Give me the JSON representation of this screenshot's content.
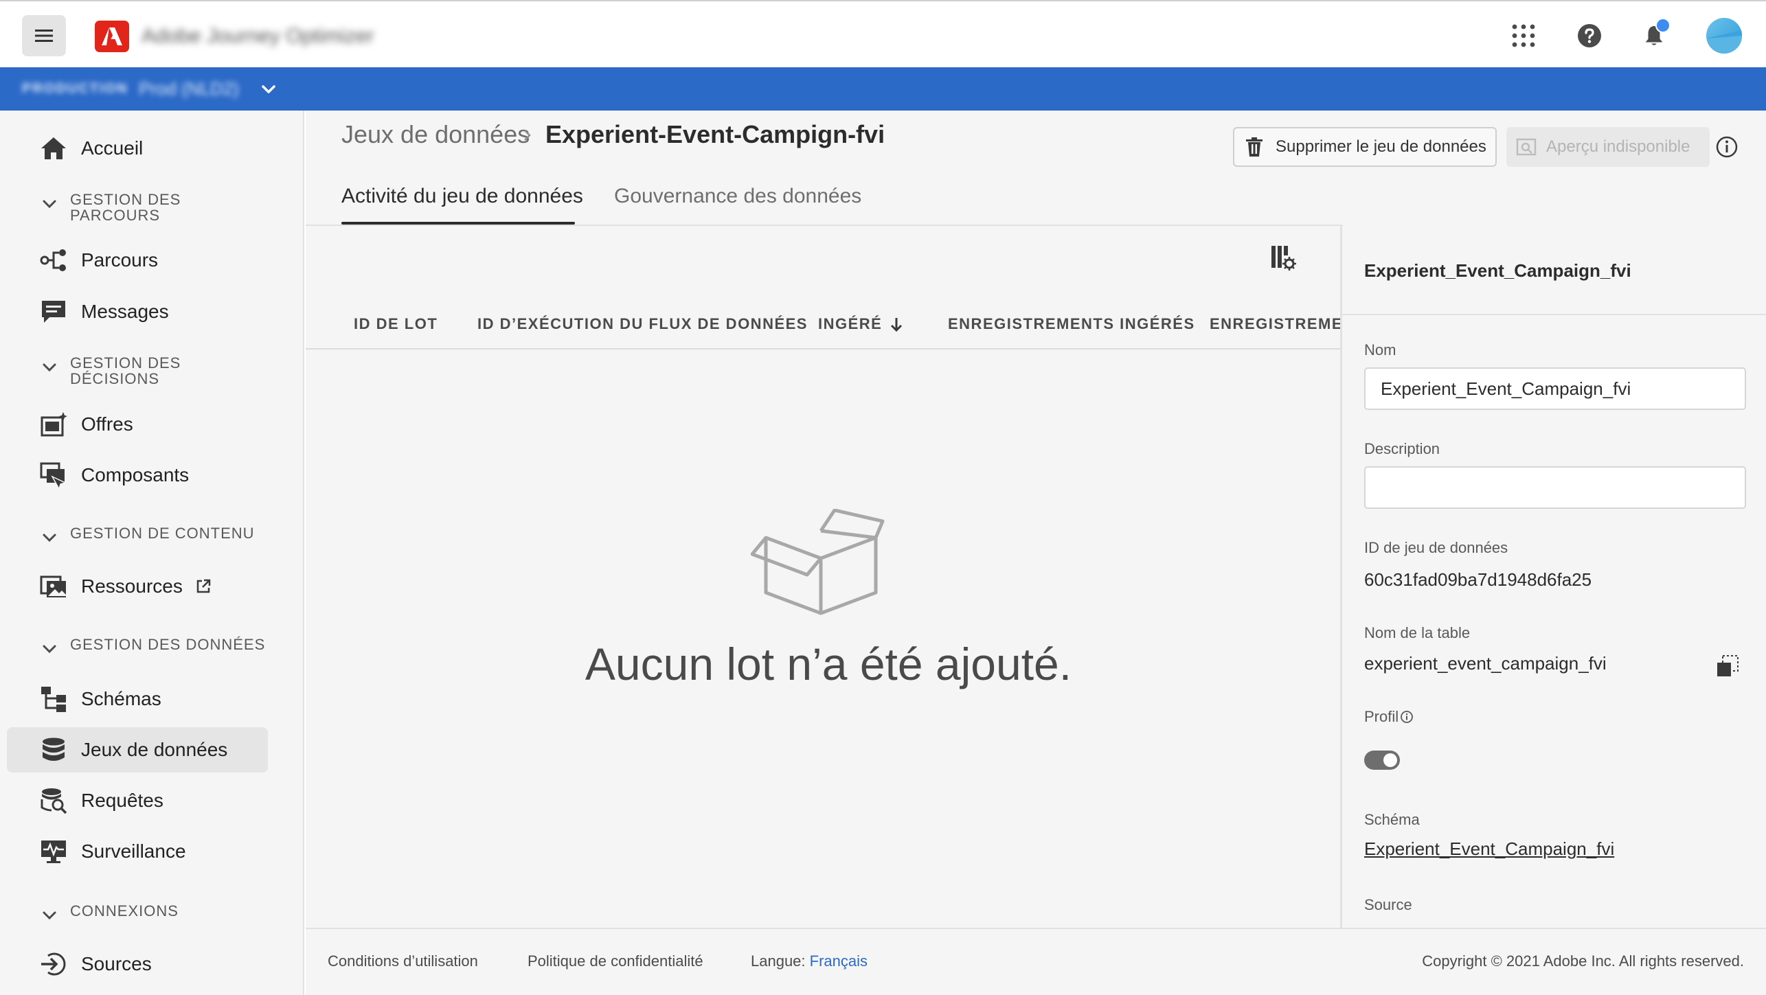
{
  "header": {
    "app_name": "Adobe Journey Optimizer",
    "icons": [
      "menu-icon",
      "adobe-logo",
      "apps-grid-icon",
      "help-icon",
      "notifications-icon",
      "user-avatar"
    ]
  },
  "orgbar": {
    "environment": "PRODUCTION",
    "sandbox": "Prod (NLD2)"
  },
  "sidebar": {
    "items": [
      {
        "label": "Accueil",
        "icon": "home-icon"
      },
      {
        "section": "GESTION DES PARCOURS"
      },
      {
        "label": "Parcours",
        "icon": "journeys-icon"
      },
      {
        "label": "Messages",
        "icon": "messages-icon"
      },
      {
        "section": "GESTION DES DÉCISIONS"
      },
      {
        "label": "Offres",
        "icon": "offers-icon"
      },
      {
        "label": "Composants",
        "icon": "components-icon"
      },
      {
        "section": "GESTION DE CONTENU"
      },
      {
        "label": "Ressources",
        "icon": "assets-icon"
      },
      {
        "section": "GESTION DES DONNÉES"
      },
      {
        "label": "Schémas",
        "icon": "schemas-icon"
      },
      {
        "label": "Jeux de données",
        "icon": "datasets-icon",
        "selected": true
      },
      {
        "label": "Requêtes",
        "icon": "queries-icon"
      },
      {
        "label": "Surveillance",
        "icon": "monitoring-icon"
      },
      {
        "section": "CONNEXIONS"
      },
      {
        "label": "Sources",
        "icon": "sources-icon"
      }
    ]
  },
  "breadcrumb": {
    "parent": "Jeux de données",
    "current": "Experient-Event-Campign-fvi"
  },
  "actions": {
    "delete_label": "Supprimer le jeu de données",
    "preview_label": "Aperçu indisponible"
  },
  "tabs": [
    {
      "label": "Activité du jeu de données",
      "active": true
    },
    {
      "label": "Gouvernance des données",
      "active": false
    }
  ],
  "table": {
    "columns": [
      "ID DE LOT",
      "ID D’EXÉCUTION DU FLUX DE DONNÉES",
      "INGÉRÉ",
      "ENREGISTREMENTS INGÉRÉS",
      "ENREGISTREMEN"
    ],
    "sorted_column": "INGÉRÉ",
    "sort_direction": "descending",
    "rows": [],
    "empty_message": "Aucun lot n’a été ajouté."
  },
  "rail": {
    "title": "Experient_Event_Campaign_fvi",
    "name_label": "Nom",
    "name_value": "Experient_Event_Campaign_fvi",
    "description_label": "Description",
    "description_value": "",
    "dataset_id_label": "ID de jeu de données",
    "dataset_id_value": "60c31fad09ba7d1948d6fa25",
    "table_name_label": "Nom de la table",
    "table_name_value": "experient_event_campaign_fvi",
    "profile_label": "Profil",
    "profile_enabled": true,
    "schema_label": "Schéma",
    "schema_value": "Experient_Event_Campaign_fvi",
    "source_label": "Source"
  },
  "footer": {
    "terms": "Conditions d’utilisation",
    "privacy": "Politique de confidentialité",
    "language_label": "Langue:",
    "language_value": "Français",
    "copyright": "Copyright © 2021 Adobe Inc. All rights reserved."
  },
  "colors": {
    "orgbar": "#2c6ac8",
    "adobe_red": "#e1251b",
    "notification": "#3d8cf2",
    "link": "#2c6ac8"
  }
}
